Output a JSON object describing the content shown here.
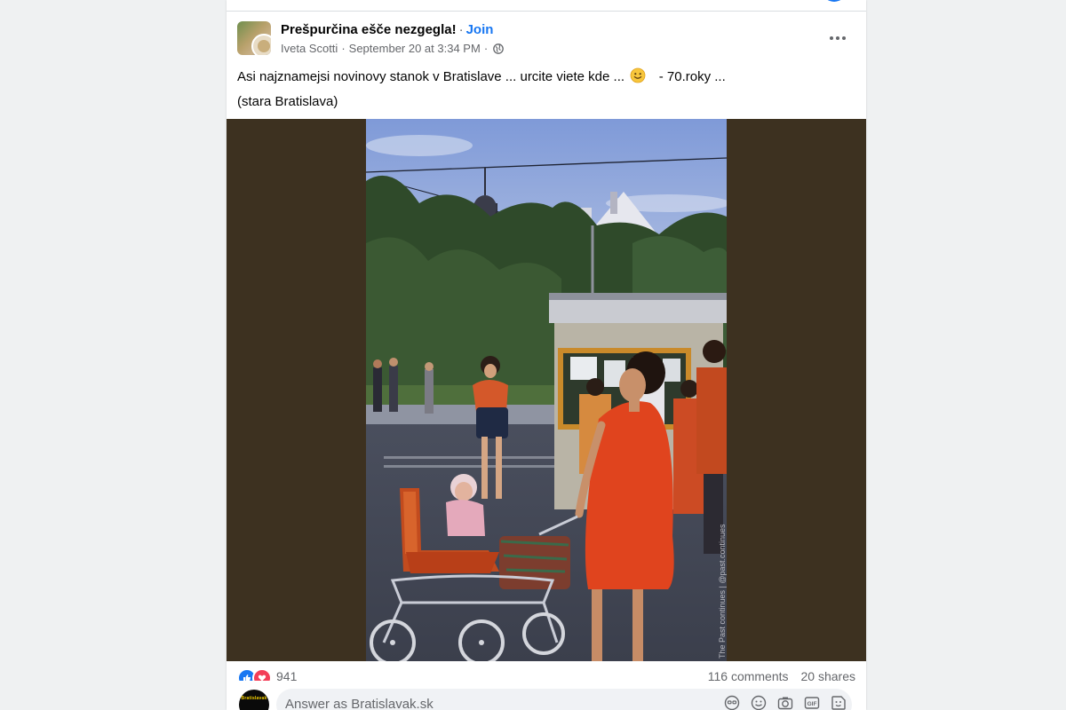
{
  "group": {
    "name": "Prešpurčina ešče nezgegla!",
    "separator": "·",
    "join_label": "Join"
  },
  "post": {
    "author": "Iveta Scotti",
    "timestamp": "September 20 at 3:34 PM",
    "meta_separator": "·",
    "privacy_icon": "globe-icon",
    "more_icon": "more-horizontal-icon",
    "text_line1_part1": "Asi najznamejsi novinovy stanok v Bratislave ... urcite viete kde ...",
    "text_line1_emoji": "slightly-smiling-face-emoji",
    "text_line1_part2": "- 70.roky  ...",
    "text_line2": "(stara Bratislava)",
    "photo_watermark": "The Past continues | @past.continues"
  },
  "engagement": {
    "reaction_icons": [
      "like-reaction-icon",
      "love-reaction-icon"
    ],
    "reaction_count": "941",
    "comments": "116 comments",
    "shares": "20 shares"
  },
  "comment_box": {
    "avatar_label": "Bratislavak",
    "placeholder": "Answer as Bratislavak.sk",
    "tools": [
      "avatar-sticker-icon",
      "emoji-icon",
      "camera-icon",
      "gif-icon",
      "sticker-icon"
    ]
  },
  "colors": {
    "accent": "#1877f2",
    "text_primary": "#050505",
    "text_secondary": "#65676b",
    "photo_matte": "#3d3120",
    "love_reaction": "#f33e58"
  }
}
